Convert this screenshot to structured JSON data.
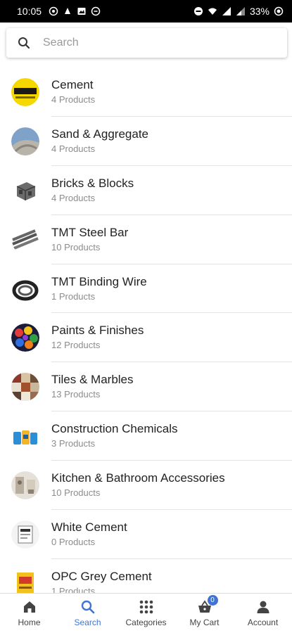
{
  "status_bar": {
    "time": "10:05",
    "battery": "33%"
  },
  "search": {
    "placeholder": "Search"
  },
  "categories": [
    {
      "name": "Cement",
      "count": "4 Products",
      "icon": "cement-brand-icon"
    },
    {
      "name": "Sand & Aggregate",
      "count": "4 Products",
      "icon": "sand-icon"
    },
    {
      "name": "Bricks & Blocks",
      "count": "4 Products",
      "icon": "brick-block-icon"
    },
    {
      "name": "TMT Steel Bar",
      "count": "10 Products",
      "icon": "steel-bar-icon"
    },
    {
      "name": "TMT Binding Wire",
      "count": "1 Products",
      "icon": "wire-coil-icon"
    },
    {
      "name": "Paints & Finishes",
      "count": "12 Products",
      "icon": "paint-cans-icon"
    },
    {
      "name": "Tiles & Marbles",
      "count": "13 Products",
      "icon": "tiles-icon"
    },
    {
      "name": "Construction Chemicals",
      "count": "3 Products",
      "icon": "chemicals-icon"
    },
    {
      "name": "Kitchen & Bathroom Accessories",
      "count": "10 Products",
      "icon": "kitchen-bath-icon"
    },
    {
      "name": "White Cement",
      "count": "0 Products",
      "icon": "white-cement-icon"
    },
    {
      "name": "OPC Grey Cement",
      "count": "1 Products",
      "icon": "grey-cement-icon"
    }
  ],
  "nav": {
    "home": "Home",
    "search": "Search",
    "categories": "Categories",
    "cart": "My Cart",
    "cart_badge": "0",
    "account": "Account"
  },
  "colors": {
    "accent": "#3f74d4",
    "status_bar": "#000000",
    "divider": "#e3e3e3"
  }
}
